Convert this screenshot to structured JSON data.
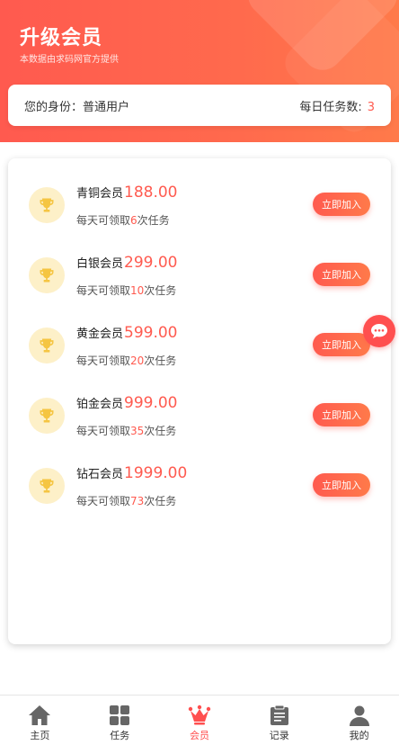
{
  "header": {
    "title": "升级会员",
    "subtitle": "本数据由求码网官方提供"
  },
  "identity": {
    "label": "您的身份：普通用户",
    "tasks_label": "每日任务数:",
    "tasks_value": "3"
  },
  "levels": [
    {
      "name": "青铜会员",
      "price": "188.00",
      "desc_prefix": "每天可领取",
      "count": "6",
      "desc_suffix": "次任务",
      "button": "立即加入"
    },
    {
      "name": "白银会员",
      "price": "299.00",
      "desc_prefix": "每天可领取",
      "count": "10",
      "desc_suffix": "次任务",
      "button": "立即加入"
    },
    {
      "name": "黄金会员",
      "price": "599.00",
      "desc_prefix": "每天可领取",
      "count": "20",
      "desc_suffix": "次任务",
      "button": "立即加入"
    },
    {
      "name": "铂金会员",
      "price": "999.00",
      "desc_prefix": "每天可领取",
      "count": "35",
      "desc_suffix": "次任务",
      "button": "立即加入"
    },
    {
      "name": "钻石会员",
      "price": "1999.00",
      "desc_prefix": "每天可领取",
      "count": "73",
      "desc_suffix": "次任务",
      "button": "立即加入"
    }
  ],
  "tabs": [
    {
      "label": "主页",
      "icon": "home-icon",
      "active": false
    },
    {
      "label": "任务",
      "icon": "grid-icon",
      "active": false
    },
    {
      "label": "会员",
      "icon": "crown-icon",
      "active": true
    },
    {
      "label": "记录",
      "icon": "clipboard-icon",
      "active": false
    },
    {
      "label": "我的",
      "icon": "user-icon",
      "active": false
    }
  ],
  "colors": {
    "accent": "#ff5a4f",
    "trophy_bg": "#fdf0c8",
    "trophy": "#f5c542"
  }
}
